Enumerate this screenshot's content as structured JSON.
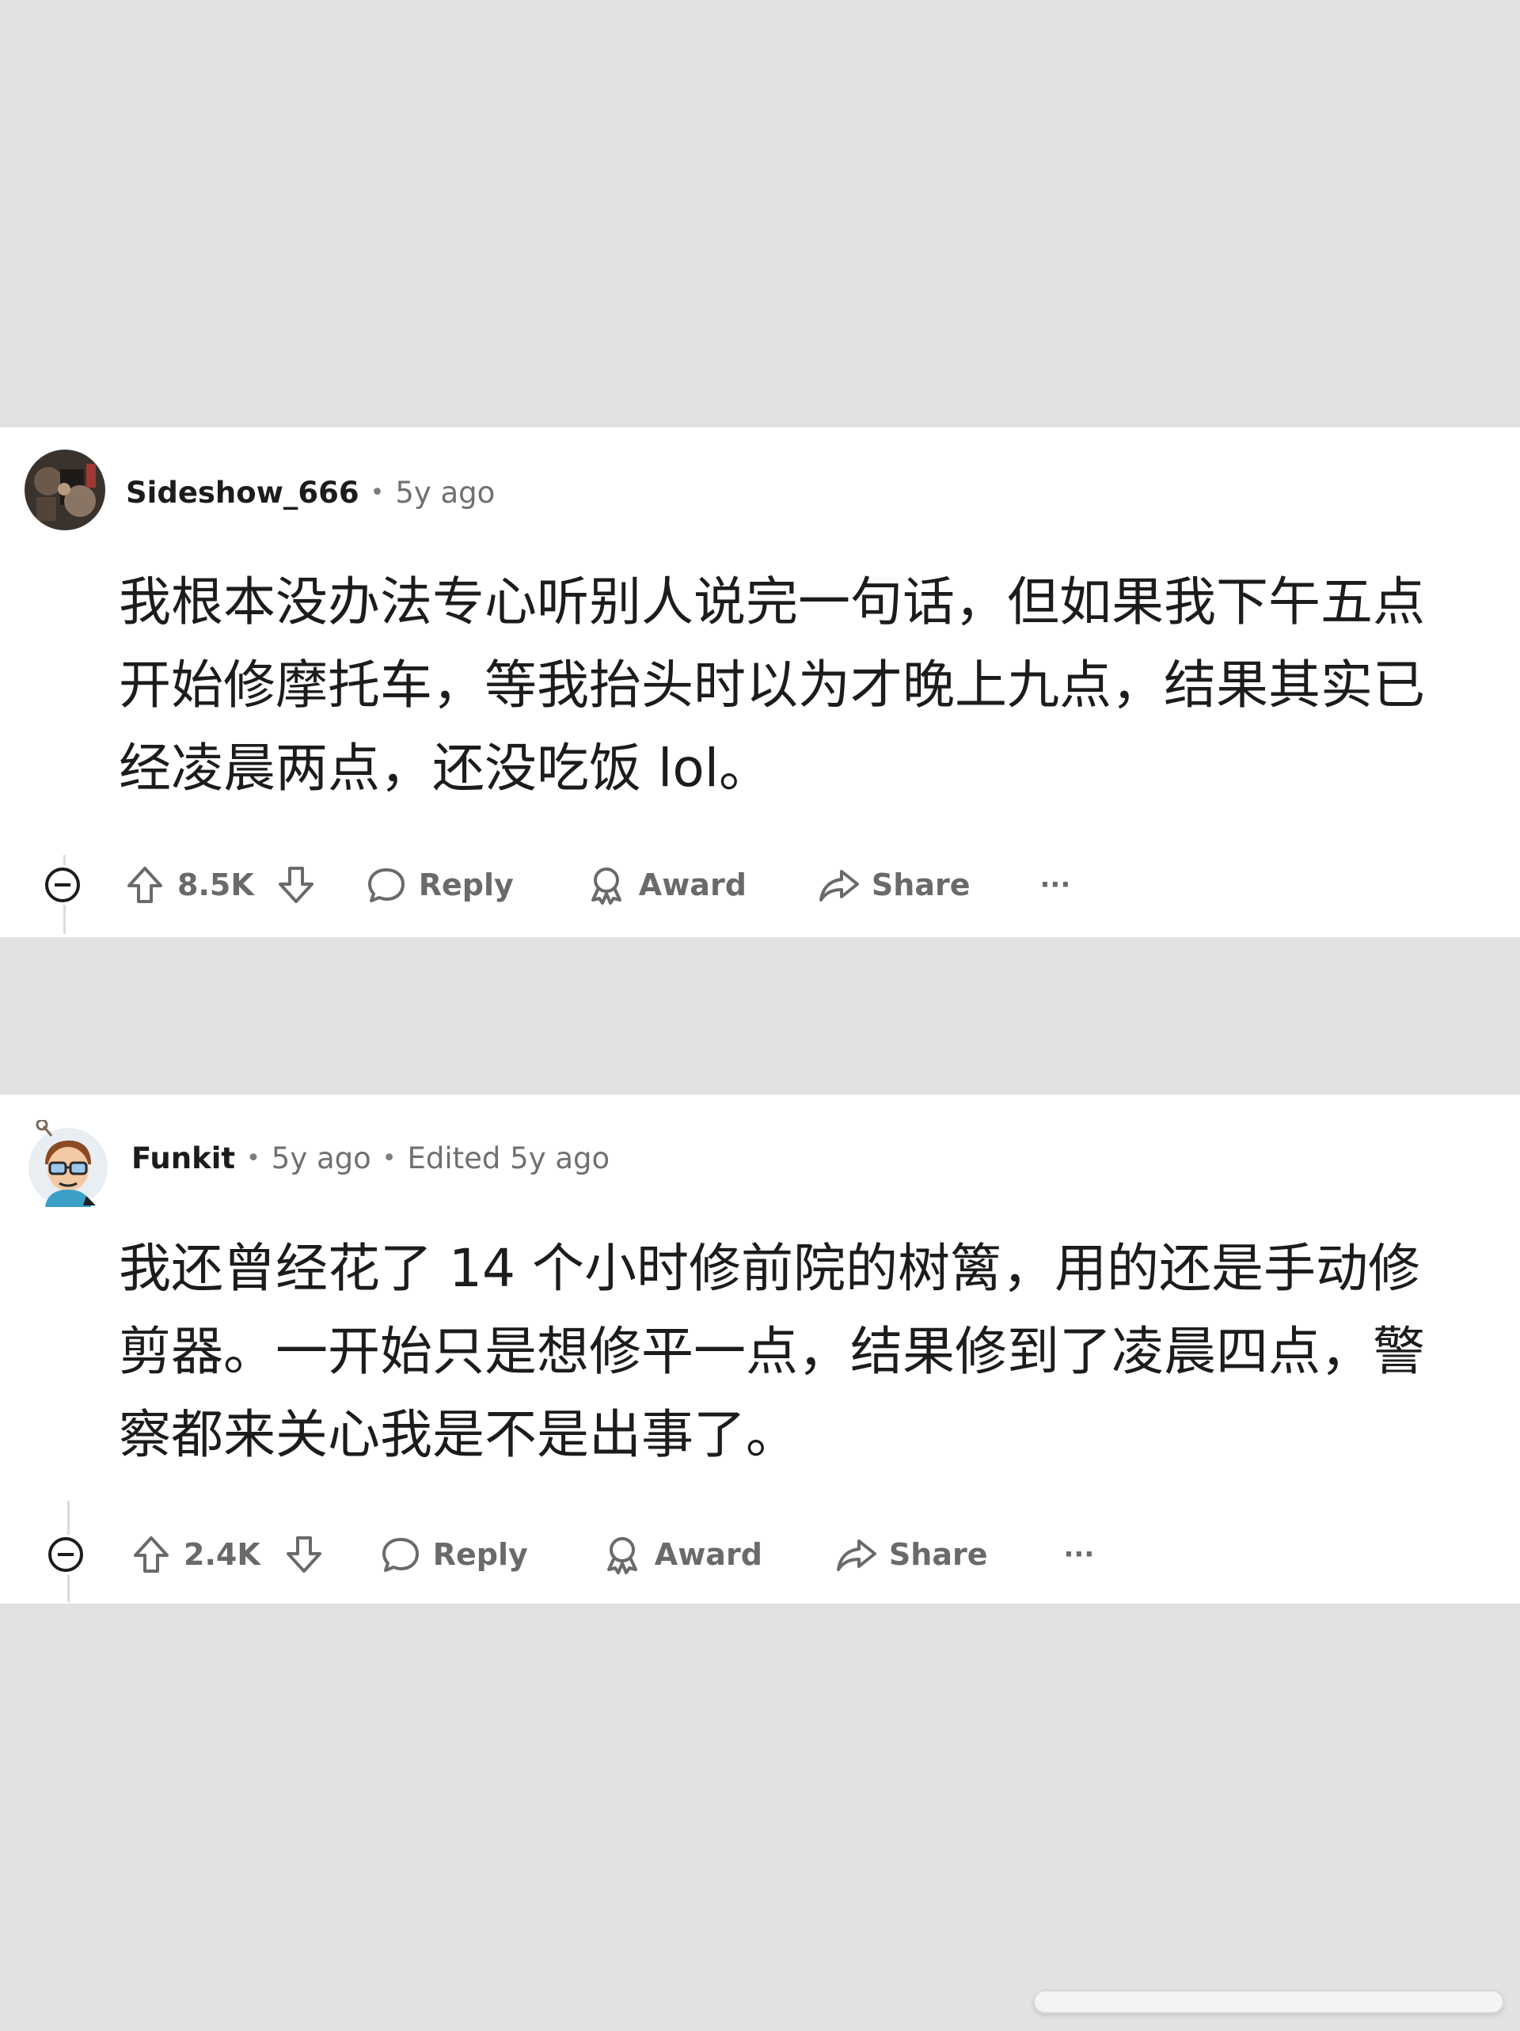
{
  "comments": [
    {
      "username": "Sideshow_666",
      "time": "5y ago",
      "edited": "",
      "body": "我根本没办法专心听别人说完一句话，但如果我下午五点开始修摩托车，等我抬头时以为才晚上九点，结果其实已经凌晨两点，还没吃饭 lol。",
      "score": "8.5K",
      "reply_label": "Reply",
      "award_label": "Award",
      "share_label": "Share",
      "more_label": "···"
    },
    {
      "username": "Funkit",
      "time": "5y ago",
      "edited": "Edited 5y ago",
      "body": "我还曾经花了 14 个小时修前院的树篱，用的还是手动修剪器。一开始只是想修平一点，结果修到了凌晨四点，警察都来关心我是不是出事了。",
      "score": "2.4K",
      "reply_label": "Reply",
      "award_label": "Award",
      "share_label": "Share",
      "more_label": "···"
    }
  ],
  "colors": {
    "background": "#e2e2e2",
    "card": "#ffffff",
    "text": "#1c1c1c",
    "muted": "#6a6a6a"
  },
  "icons": [
    "collapse-icon",
    "upvote-icon",
    "downvote-icon",
    "reply-icon",
    "award-icon",
    "share-icon",
    "more-icon"
  ]
}
